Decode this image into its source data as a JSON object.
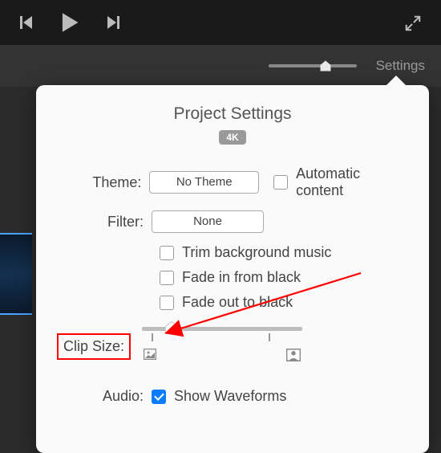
{
  "toolbar": {
    "settings_label": "Settings"
  },
  "panel": {
    "title": "Project Settings",
    "badge": "4K",
    "theme_label": "Theme:",
    "theme_value": "No Theme",
    "automatic_content": "Automatic content",
    "filter_label": "Filter:",
    "filter_value": "None",
    "trim_bg": "Trim background music",
    "fade_in": "Fade in from black",
    "fade_out": "Fade out to black",
    "clip_size_label": "Clip Size:",
    "audio_label": "Audio:",
    "show_waveforms": "Show Waveforms"
  }
}
